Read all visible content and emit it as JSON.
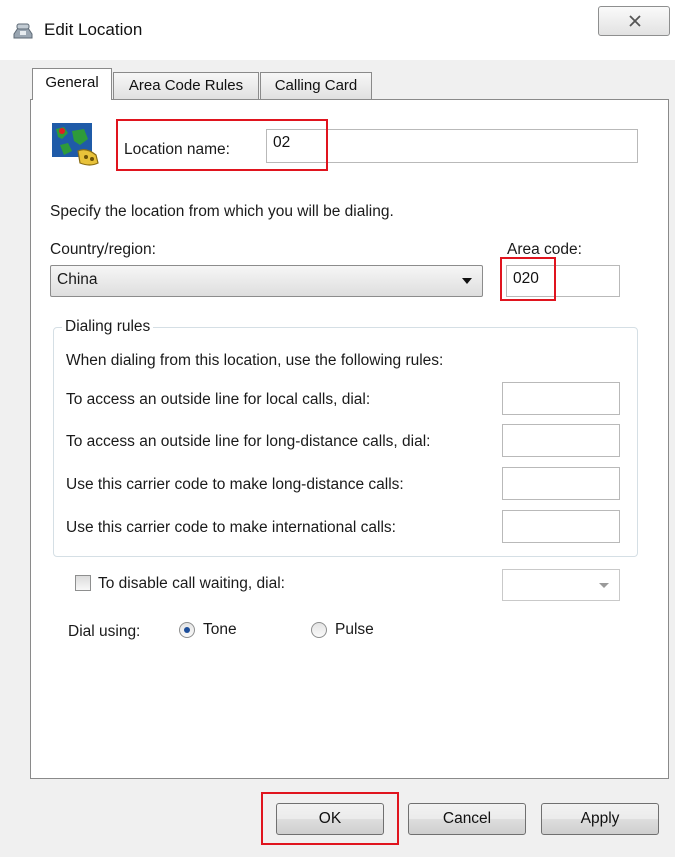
{
  "window": {
    "title": "Edit Location",
    "close_glyph": "✕"
  },
  "tabs": [
    {
      "label": "General",
      "active": true
    },
    {
      "label": "Area Code Rules",
      "active": false
    },
    {
      "label": "Calling Card",
      "active": false
    }
  ],
  "general": {
    "location_name_label": "Location name:",
    "location_name_value": "02",
    "specify_text": "Specify the location from which you will be dialing.",
    "country_label": "Country/region:",
    "country_value": "China",
    "area_code_label": "Area code:",
    "area_code_value": "020",
    "dialing_rules": {
      "title": "Dialing rules",
      "intro": "When dialing from this location, use the following rules:",
      "rows": [
        {
          "label": "To access an outside line for local calls, dial:",
          "value": ""
        },
        {
          "label": "To access an outside line for long-distance calls, dial:",
          "value": ""
        },
        {
          "label": "Use this carrier code to make long-distance calls:",
          "value": ""
        },
        {
          "label": "Use this carrier code to make international calls:",
          "value": ""
        }
      ]
    },
    "call_waiting_label": "To disable call waiting, dial:",
    "call_waiting_checked": false,
    "dial_using_label": "Dial using:",
    "tone_label": "Tone",
    "pulse_label": "Pulse",
    "dial_mode": "Tone"
  },
  "buttons": {
    "ok": "OK",
    "cancel": "Cancel",
    "apply": "Apply"
  },
  "icons": [
    "phone-icon",
    "close-icon",
    "location-map-icon",
    "dropdown-arrow-icon"
  ],
  "colors": {
    "highlight": "#e0141e",
    "window_bg": "#f0f0f0",
    "panel_bg": "#ffffff",
    "radio_dot": "#1d4e9a"
  }
}
